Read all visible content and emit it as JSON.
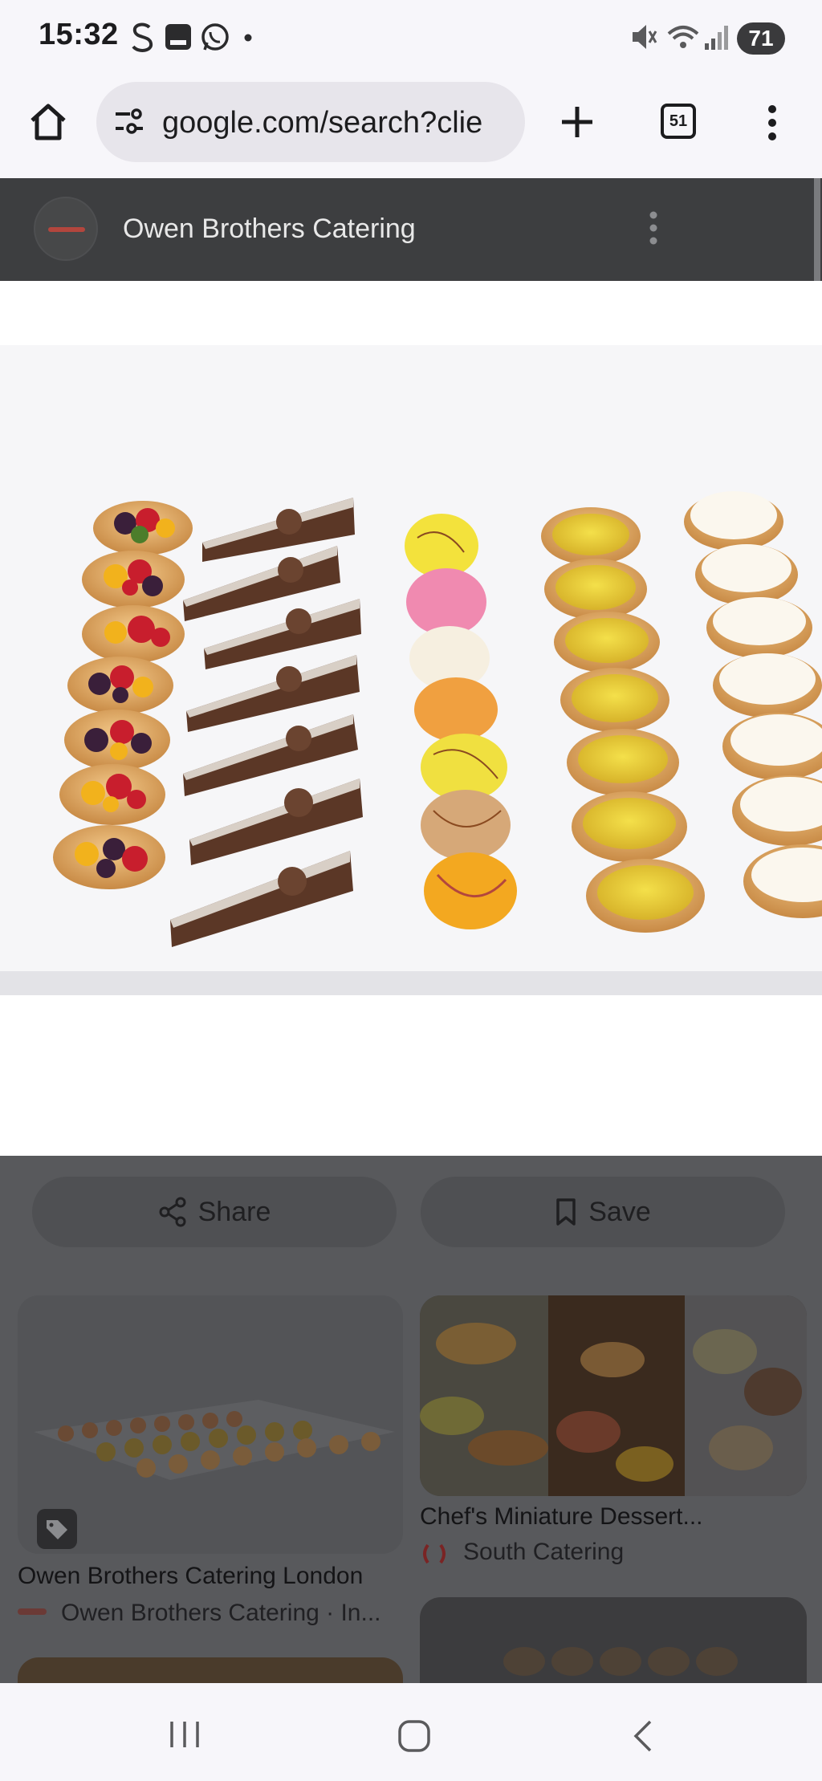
{
  "status_bar": {
    "time": "15:32",
    "battery": "71",
    "left_icons": [
      "s-icon",
      "tray-icon",
      "whatsapp-icon",
      "dot"
    ],
    "right_icons": [
      "mute-icon",
      "wifi-icon",
      "signal-icon"
    ]
  },
  "browser": {
    "url": "google.com/search?clie",
    "tab_count": "51"
  },
  "viewer": {
    "source_name": "Owen Brothers Catering"
  },
  "actions": {
    "share_label": "Share",
    "save_label": "Save"
  },
  "results": [
    {
      "title": "Owen Brothers Catering London",
      "source": "Owen Brothers Catering · In..."
    },
    {
      "title": "Chef's Miniature Dessert...",
      "source": "South Catering"
    }
  ],
  "colors": {
    "scrim": "#3d3e40",
    "chrome": "#f7f6fa",
    "accent_red": "#b3463d"
  }
}
